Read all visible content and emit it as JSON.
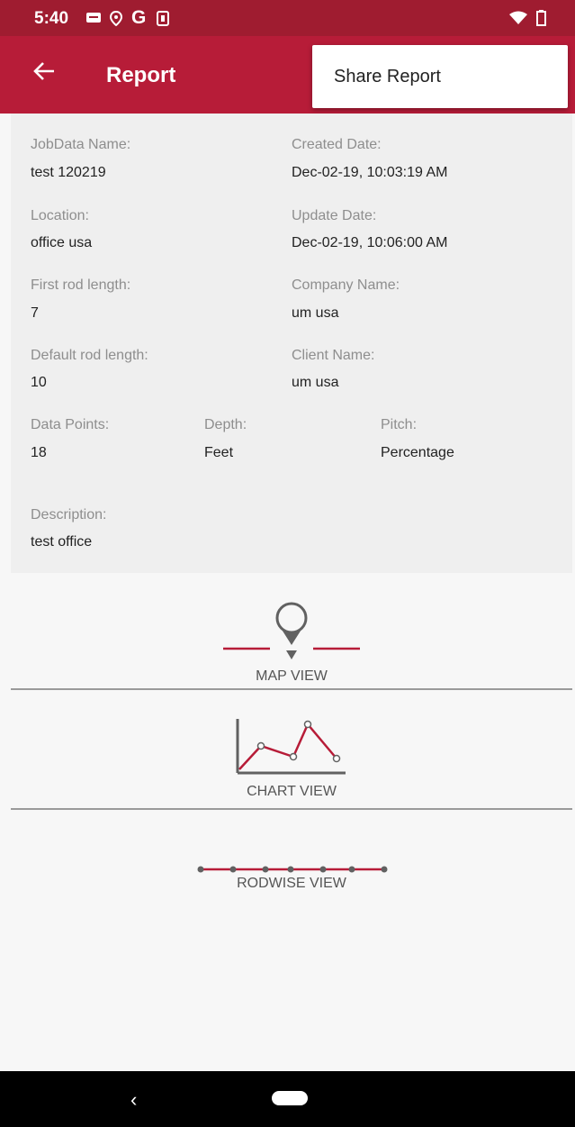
{
  "status_bar": {
    "time": "5:40",
    "icons": [
      "message-icon",
      "location-icon",
      "google-icon",
      "phone-icon",
      "wifi-icon",
      "battery-icon"
    ]
  },
  "app_bar": {
    "title": "Report",
    "back_icon": "arrow-back-icon",
    "background": "#b71c38",
    "status_background": "#9f1c30"
  },
  "overflow_menu": {
    "items": [
      {
        "label": "Share Report"
      }
    ]
  },
  "details": {
    "job_name": {
      "label": "JobData Name:",
      "value": "test 120219"
    },
    "created_date": {
      "label": "Created Date:",
      "value": "Dec-02-19, 10:03:19 AM"
    },
    "location": {
      "label": "Location:",
      "value": "office usa"
    },
    "update_date": {
      "label": "Update Date:",
      "value": "Dec-02-19, 10:06:00 AM"
    },
    "first_rod_length": {
      "label": "First rod length:",
      "value": "7"
    },
    "company_name": {
      "label": "Company Name:",
      "value": "um usa"
    },
    "default_rod_length": {
      "label": "Default rod length:",
      "value": "10"
    },
    "client_name": {
      "label": "Client Name:",
      "value": "um usa"
    },
    "data_points": {
      "label": "Data Points:",
      "value": "18"
    },
    "depth": {
      "label": "Depth:",
      "value": "Feet"
    },
    "pitch": {
      "label": "Pitch:",
      "value": "Percentage"
    },
    "description": {
      "label": "Description:",
      "value": "test office"
    }
  },
  "views": {
    "map": {
      "label": "MAP VIEW",
      "icon": "map-pin-icon"
    },
    "chart": {
      "label": "CHART VIEW",
      "icon": "line-chart-icon"
    },
    "rodwise": {
      "label": "RODWISE VIEW",
      "icon": "rodwise-icon"
    }
  },
  "accent_color": "#b71c38"
}
